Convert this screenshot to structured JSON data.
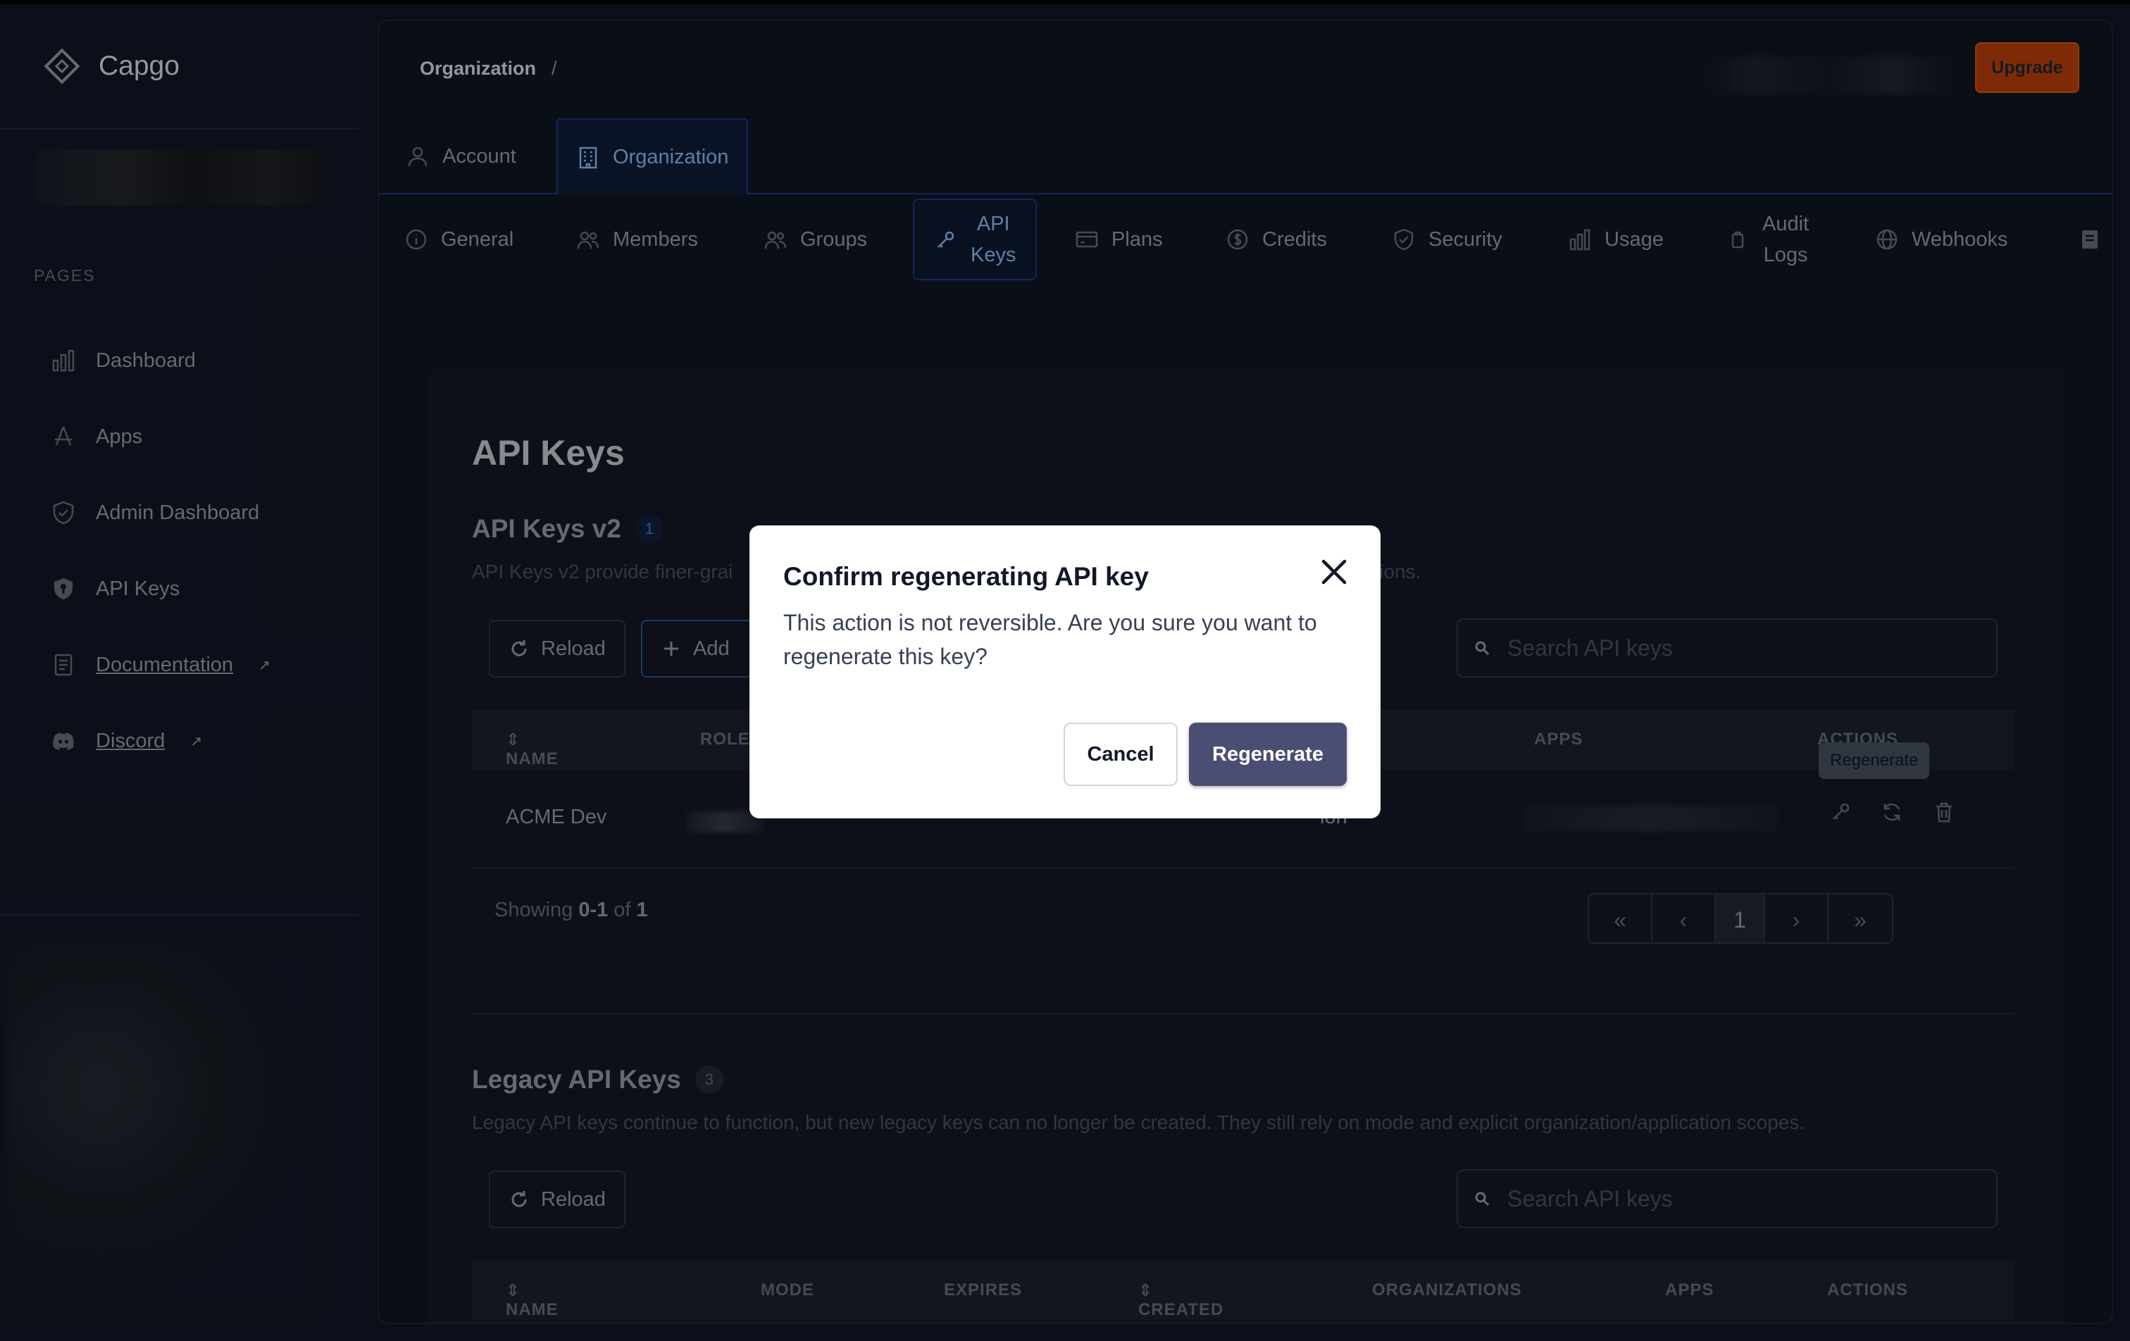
{
  "brand": {
    "name": "Capgo"
  },
  "sidebar": {
    "section_label": "PAGES",
    "items": [
      {
        "label": "Dashboard",
        "icon": "bar-chart-icon"
      },
      {
        "label": "Apps",
        "icon": "app-store-icon"
      },
      {
        "label": "Admin Dashboard",
        "icon": "shield-icon"
      },
      {
        "label": "API Keys",
        "icon": "shield-key-icon"
      },
      {
        "label": "Documentation",
        "icon": "document-icon",
        "external": true
      },
      {
        "label": "Discord",
        "icon": "discord-icon",
        "external": true
      }
    ]
  },
  "header": {
    "breadcrumb": "Organization",
    "breadcrumb_sep": "/",
    "upgrade_label": "Upgrade"
  },
  "tabs_primary": [
    {
      "label": "Account",
      "icon": "user-icon",
      "active": false
    },
    {
      "label": "Organization",
      "icon": "building-icon",
      "active": true
    }
  ],
  "tabs_secondary": [
    {
      "label": "General",
      "icon": "info-icon"
    },
    {
      "label": "Members",
      "icon": "users-icon"
    },
    {
      "label": "Groups",
      "icon": "users-group-icon"
    },
    {
      "label_line1": "API",
      "label_line2": "Keys",
      "icon": "key-icon",
      "active": true
    },
    {
      "label": "Plans",
      "icon": "credit-card-icon"
    },
    {
      "label": "Credits",
      "icon": "dollar-circle-icon"
    },
    {
      "label": "Security",
      "icon": "shield-check-icon"
    },
    {
      "label": "Usage",
      "icon": "bar-chart-icon"
    },
    {
      "label_line1": "Audit",
      "label_line2": "Logs",
      "icon": "clipboard-icon"
    },
    {
      "label": "Webhooks",
      "icon": "globe-icon"
    }
  ],
  "page": {
    "title": "API Keys",
    "v2": {
      "title": "API Keys v2",
      "count": "1",
      "desc_left": "API Keys v2 provide finer-grai",
      "desc_right": "issions.",
      "reload_label": "Reload",
      "add_label": "Add",
      "search_placeholder": "Search API keys",
      "columns": [
        "NAME",
        "ROLE",
        "APPS",
        "ACTIONS"
      ],
      "rows": [
        {
          "name": "ACME Dev",
          "partial": "ion"
        }
      ],
      "tooltip": "Regenerate",
      "showing_prefix": "Showing ",
      "showing_range": "0-1",
      "showing_of": " of ",
      "showing_total": "1",
      "pager": [
        "«",
        "‹",
        "1",
        "›",
        "»"
      ]
    },
    "legacy": {
      "title": "Legacy API Keys",
      "count": "3",
      "desc": "Legacy API keys continue to function, but new legacy keys can no longer be created. They still rely on mode and explicit organization/application scopes.",
      "reload_label": "Reload",
      "search_placeholder": "Search API keys",
      "columns": [
        "NAME",
        "MODE",
        "EXPIRES",
        "CREATED",
        "ORGANIZATIONS",
        "APPS",
        "ACTIONS"
      ]
    }
  },
  "modal": {
    "title": "Confirm regenerating API key",
    "body": "This action is not reversible. Are you sure you want to regenerate this key?",
    "cancel_label": "Cancel",
    "confirm_label": "Regenerate"
  }
}
